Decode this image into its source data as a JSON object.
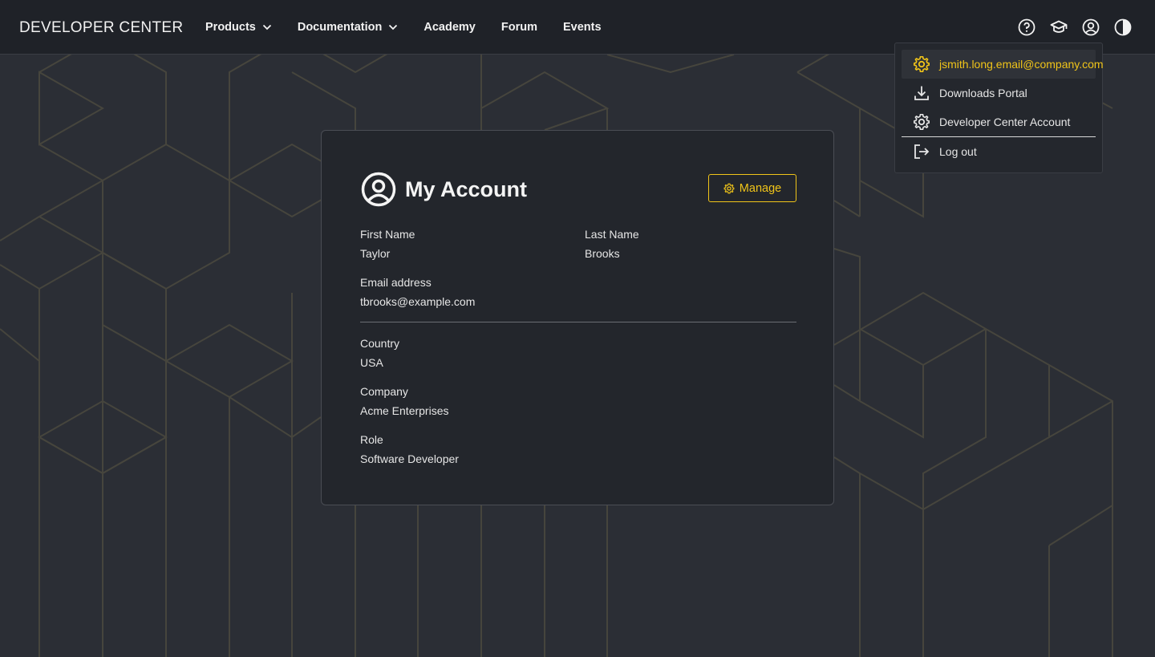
{
  "brand": "DEVELOPER CENTER",
  "nav": {
    "products": "Products",
    "documentation": "Documentation",
    "academy": "Academy",
    "forum": "Forum",
    "events": "Events"
  },
  "icons": {
    "help": "help-icon",
    "academy": "graduation-cap-icon",
    "account": "user-circle-icon",
    "theme": "contrast-icon"
  },
  "dropdown": {
    "email": "jsmith.long.email@company.com",
    "downloads": "Downloads Portal",
    "account": "Developer Center Account",
    "logout": "Log out"
  },
  "card": {
    "title": "My Account",
    "manage_label": "Manage",
    "fields": {
      "first_name_label": "First Name",
      "first_name_value": "Taylor",
      "last_name_label": "Last Name",
      "last_name_value": "Brooks",
      "email_label": "Email address",
      "email_value": "tbrooks@example.com",
      "country_label": "Country",
      "country_value": "USA",
      "company_label": "Company",
      "company_value": "Acme Enterprises",
      "role_label": "Role",
      "role_value": "Software Developer"
    }
  },
  "colors": {
    "accent": "#f0c419",
    "background": "#2b2e35",
    "topbar": "#1f2228",
    "card": "#23262c"
  }
}
